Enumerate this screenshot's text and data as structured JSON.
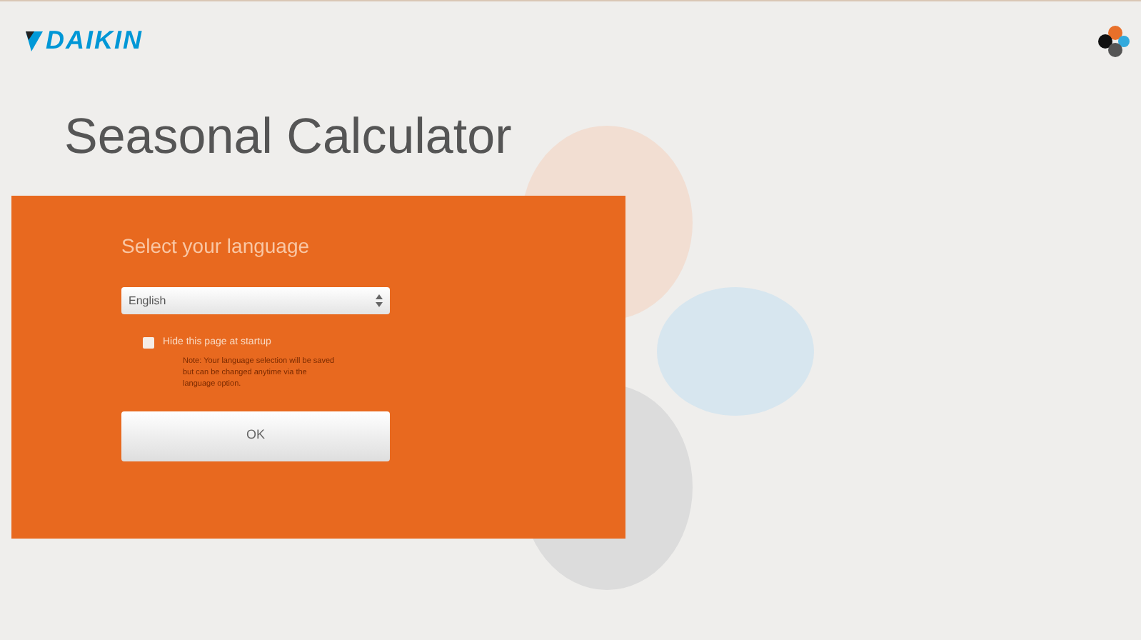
{
  "header": {
    "logo_text": "DAIKIN"
  },
  "title": "Seasonal Calculator",
  "dialog": {
    "heading": "Select your language",
    "language_select": {
      "value": "English"
    },
    "hide_option": {
      "label": "Hide this page at startup",
      "checked": false
    },
    "note": "Note: Your language selection will be saved but can be changed anytime via the language option.",
    "ok_button": "OK"
  }
}
